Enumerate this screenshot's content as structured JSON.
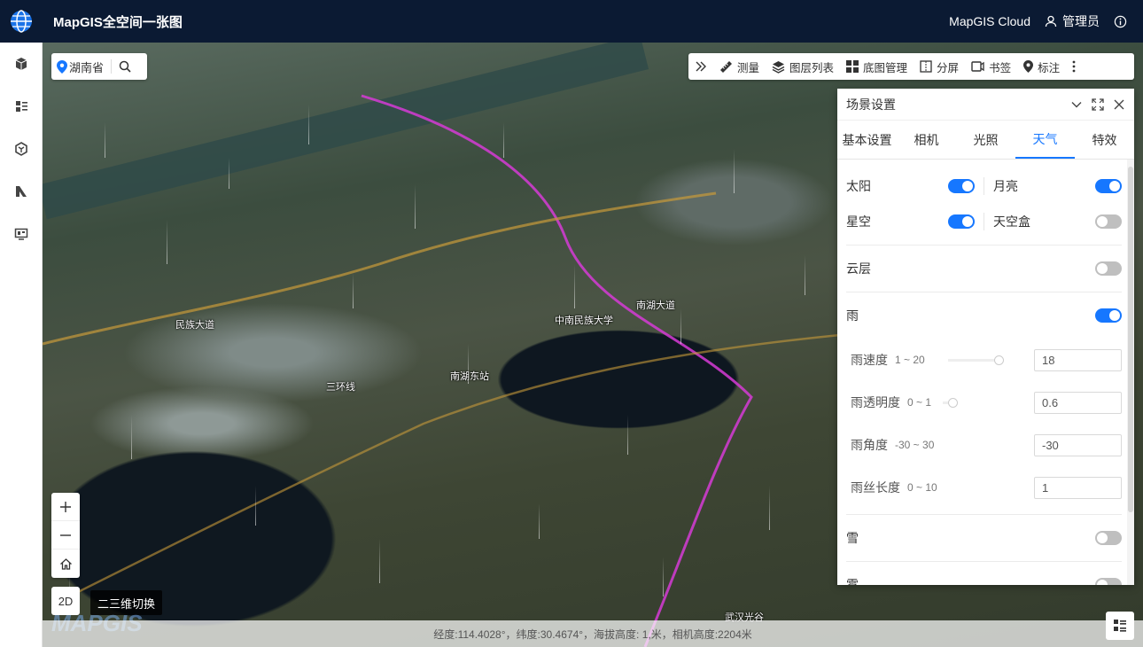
{
  "header": {
    "title": "MapGIS全空间一张图",
    "cloud_label": "MapGIS Cloud",
    "user_label": "管理员"
  },
  "sidebar": {
    "items": [
      {
        "icon": "cube-icon"
      },
      {
        "icon": "layers-list-icon"
      },
      {
        "icon": "model-icon"
      },
      {
        "icon": "analysis-icon"
      },
      {
        "icon": "screen-icon"
      }
    ]
  },
  "search": {
    "location": "湖南省"
  },
  "toolbar": {
    "measure": "测量",
    "layers": "图层列表",
    "basemap": "底图管理",
    "split": "分屏",
    "bookmark": "书签",
    "mark": "标注"
  },
  "panel": {
    "title": "场景设置",
    "tabs": [
      "基本设置",
      "相机",
      "光照",
      "天气",
      "特效"
    ],
    "active_tab": "天气",
    "sun": {
      "label": "太阳",
      "on": true
    },
    "moon": {
      "label": "月亮",
      "on": true
    },
    "stars": {
      "label": "星空",
      "on": true
    },
    "skybox": {
      "label": "天空盒",
      "on": false
    },
    "cloud": {
      "label": "云层",
      "on": false
    },
    "rain": {
      "label": "雨",
      "on": true
    },
    "rain_params": [
      {
        "name": "雨速度",
        "range": "1 ~ 20",
        "value": "18"
      },
      {
        "name": "雨透明度",
        "range": "0 ~ 1",
        "value": "0.6"
      },
      {
        "name": "雨角度",
        "range": "-30 ~ 30",
        "value": "-30"
      },
      {
        "name": "雨丝长度",
        "range": "0 ~ 10",
        "value": "1"
      }
    ],
    "snow": {
      "label": "雪",
      "on": false
    },
    "fog": {
      "label": "雾",
      "on": false
    }
  },
  "map": {
    "labels": [
      "南湖东站",
      "中南民族大学",
      "三环线",
      "南湖大道",
      "武汉光谷",
      "民族大道"
    ],
    "switch_2d": "2D",
    "switch_tip": "二三维切换",
    "status": "经度:114.4028°，纬度:30.4674°，海拔高度: 1,米，相机高度:2204米",
    "watermark": "MAPGIS"
  }
}
